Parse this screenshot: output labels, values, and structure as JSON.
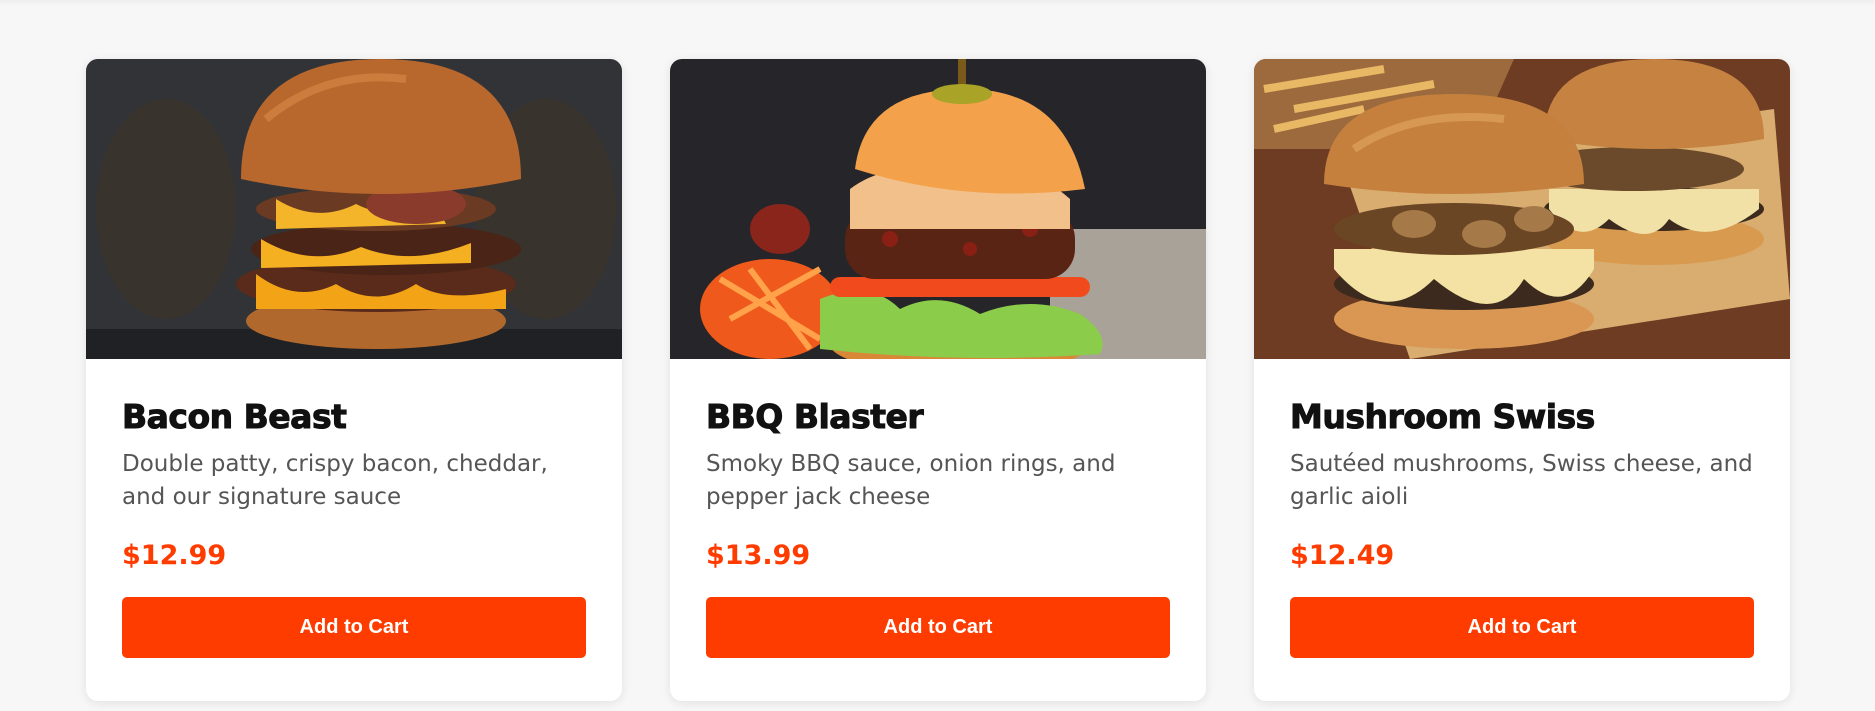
{
  "colors": {
    "accent": "#ff3c00",
    "title": "#111111",
    "description": "#555555",
    "background": "#f7f7f7"
  },
  "products": [
    {
      "image": "bacon-beast-burger-photo",
      "name": "Bacon Beast",
      "description": "Double patty, crispy bacon, cheddar, and our signature sauce",
      "price": "$12.99",
      "button_label": "Add to Cart"
    },
    {
      "image": "bbq-blaster-burger-photo",
      "name": "BBQ Blaster",
      "description": "Smoky BBQ sauce, onion rings, and pepper jack cheese",
      "price": "$13.99",
      "button_label": "Add to Cart"
    },
    {
      "image": "mushroom-swiss-burger-photo",
      "name": "Mushroom Swiss",
      "description": "Sautéed mushrooms, Swiss cheese, and garlic aioli",
      "price": "$12.49",
      "button_label": "Add to Cart"
    }
  ]
}
